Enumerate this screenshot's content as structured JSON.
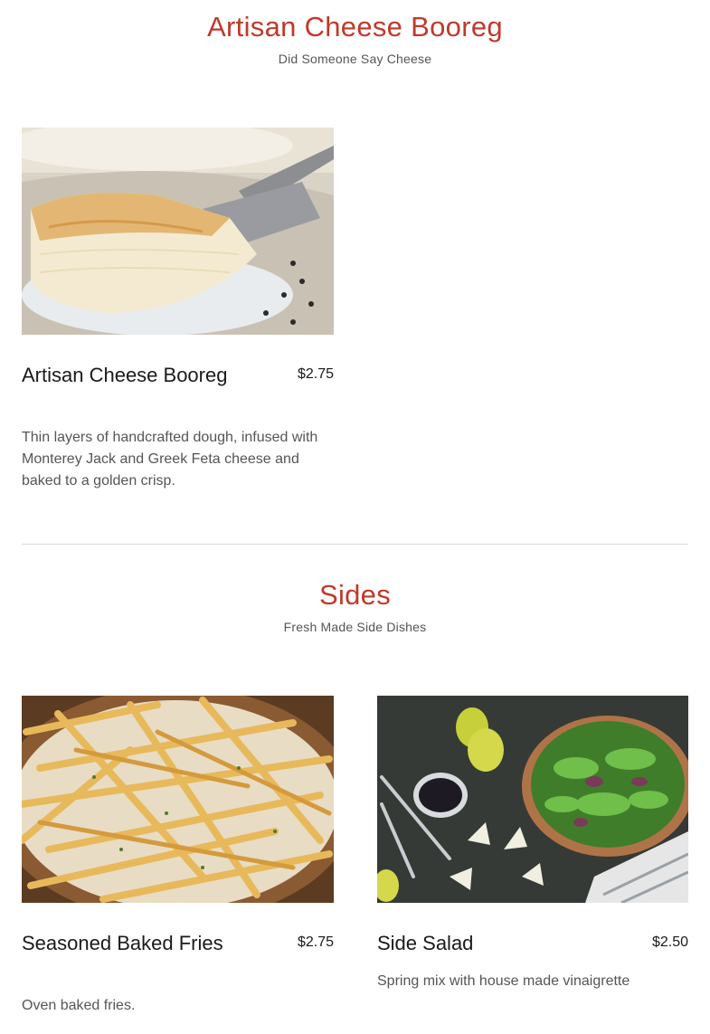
{
  "sections": [
    {
      "title": "Artisan Cheese Booreg",
      "subtitle": "Did Someone Say Cheese",
      "items": [
        {
          "name": "Artisan Cheese Booreg",
          "price": "$2.75",
          "description": "Thin layers of handcrafted dough, infused with Monterey Jack and Greek Feta cheese and baked to a golden crisp.",
          "image": "cheese-booreg-photo"
        }
      ]
    },
    {
      "title": "Sides",
      "subtitle": "Fresh Made Side Dishes",
      "items": [
        {
          "name": "Seasoned Baked Fries",
          "price": "$2.75",
          "description": "Oven baked fries.",
          "image": "baked-fries-photo"
        },
        {
          "name": "Side Salad",
          "price": "$2.50",
          "description": "Spring mix with house made vinaigrette",
          "image": "side-salad-photo"
        }
      ]
    }
  ],
  "colors": {
    "accent": "#c0392b",
    "text": "#1a1a1a",
    "muted": "#555555",
    "divider": "#dcdcdc"
  }
}
